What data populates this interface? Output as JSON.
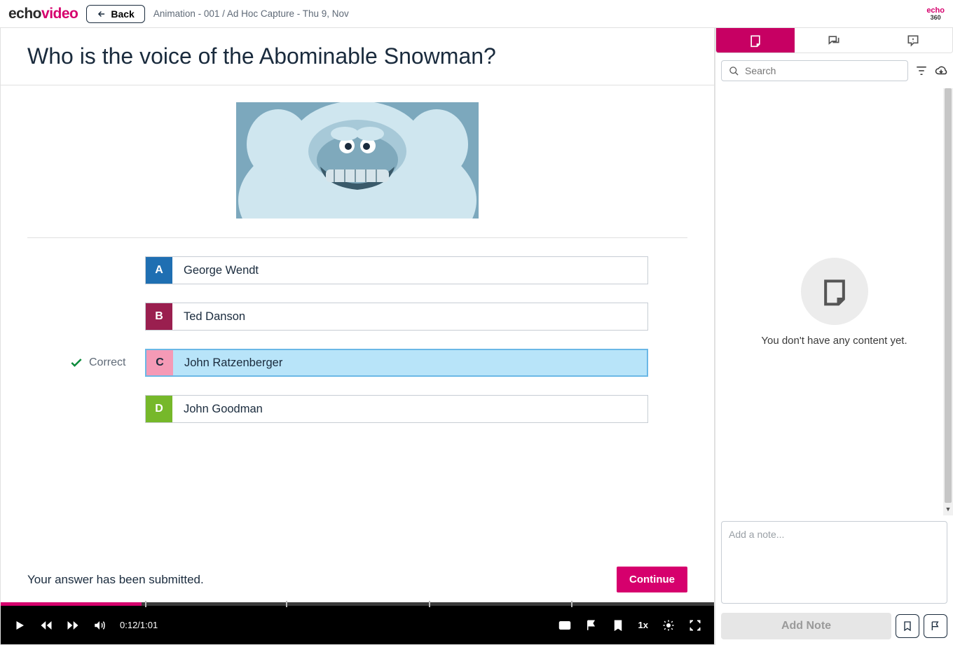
{
  "header": {
    "logo_part1": "echo",
    "logo_part2": "video",
    "back_label": "Back",
    "breadcrumb": "Animation - 001 / Ad Hoc Capture - Thu 9, Nov",
    "mini_logo": "echo",
    "mini_logo_sub": "360"
  },
  "question": {
    "title": "Who is the voice of the Abominable Snowman?",
    "options": [
      {
        "letter": "A",
        "text": "George Wendt",
        "letter_class": "letter-A"
      },
      {
        "letter": "B",
        "text": "Ted Danson",
        "letter_class": "letter-B"
      },
      {
        "letter": "C",
        "text": "John Ratzenberger",
        "letter_class": "letter-C",
        "selected": true,
        "correct": true
      },
      {
        "letter": "D",
        "text": "John Goodman",
        "letter_class": "letter-D"
      }
    ],
    "correct_label": "Correct",
    "submitted_msg": "Your answer has been submitted.",
    "continue_label": "Continue"
  },
  "player": {
    "time": "0:12/1:01",
    "speed": "1x",
    "progress_percent": 19.7,
    "ticks": [
      20.2,
      40,
      60,
      80
    ]
  },
  "sidebar": {
    "search_placeholder": "Search",
    "empty_text": "You don't have any content yet.",
    "note_placeholder": "Add a note...",
    "add_note_label": "Add Note"
  }
}
